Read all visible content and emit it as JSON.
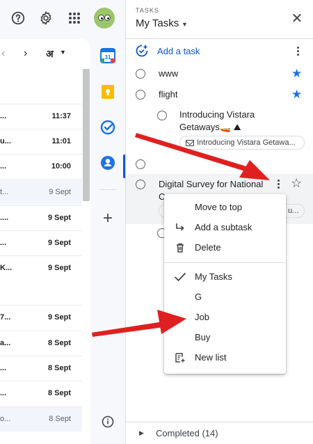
{
  "header": {
    "help_icon": "help-circle-icon",
    "settings_icon": "gear-icon",
    "apps_icon": "apps-grid-icon",
    "avatar_icon": "avatar"
  },
  "mail": {
    "pager": {
      "prev": "‹",
      "next": "›",
      "language": "अ"
    },
    "rows": [
      {
        "snip": "...",
        "time": "11:37",
        "unread": true
      },
      {
        "snip": "u...",
        "time": "11:01",
        "unread": true
      },
      {
        "snip": "...",
        "time": "10:00",
        "unread": true
      },
      {
        "snip": "t...",
        "time": "9 Sept",
        "unread": false
      },
      {
        "snip": "....",
        "time": "9 Sept",
        "unread": true
      },
      {
        "snip": "...",
        "time": "9 Sept",
        "unread": true
      },
      {
        "snip": "K...",
        "time": "9 Sept",
        "unread": true
      },
      {
        "snip": "7...",
        "time": "9 Sept",
        "unread": true
      },
      {
        "snip": "a...",
        "time": "8 Sept",
        "unread": true
      },
      {
        "snip": "...",
        "time": "8 Sept",
        "unread": true
      },
      {
        "snip": "...",
        "time": "8 Sept",
        "unread": true
      },
      {
        "snip": "o...",
        "time": "8 Sept",
        "unread": false
      }
    ]
  },
  "rail": {
    "calendar_label": "31",
    "add": "+",
    "info": "i"
  },
  "tasks": {
    "eyebrow": "TASKS",
    "title": "My Tasks",
    "add_task": "Add a task",
    "items": [
      {
        "text": "www",
        "starred": true
      },
      {
        "text": "flight",
        "starred": true
      },
      {
        "text_line1": "Introducing Vistara",
        "text_line2": "Getaways🚤 ⛰",
        "chip": "Introducing Vistara Getawa..."
      },
      {
        "text": ""
      },
      {
        "text_line1": "Digital Survey for National",
        "text_line2": "Cr",
        "chip": "u..."
      }
    ],
    "completed": "Completed (14)"
  },
  "menu": {
    "items": [
      {
        "label": "Move to top",
        "icon": ""
      },
      {
        "label": "Add a subtask",
        "icon": "subtask-arrow-icon"
      },
      {
        "label": "Delete",
        "icon": "trash-icon"
      },
      {
        "label": "My Tasks",
        "icon": "check-icon"
      },
      {
        "label": "G",
        "icon": ""
      },
      {
        "label": "Job",
        "icon": ""
      },
      {
        "label": "Buy",
        "icon": ""
      },
      {
        "label": "New list",
        "icon": "new-list-icon"
      }
    ]
  },
  "colors": {
    "accent": "#0b57d0",
    "star": "#1a73e8",
    "arrow": "#e02020",
    "background": "#f6f8fc"
  }
}
